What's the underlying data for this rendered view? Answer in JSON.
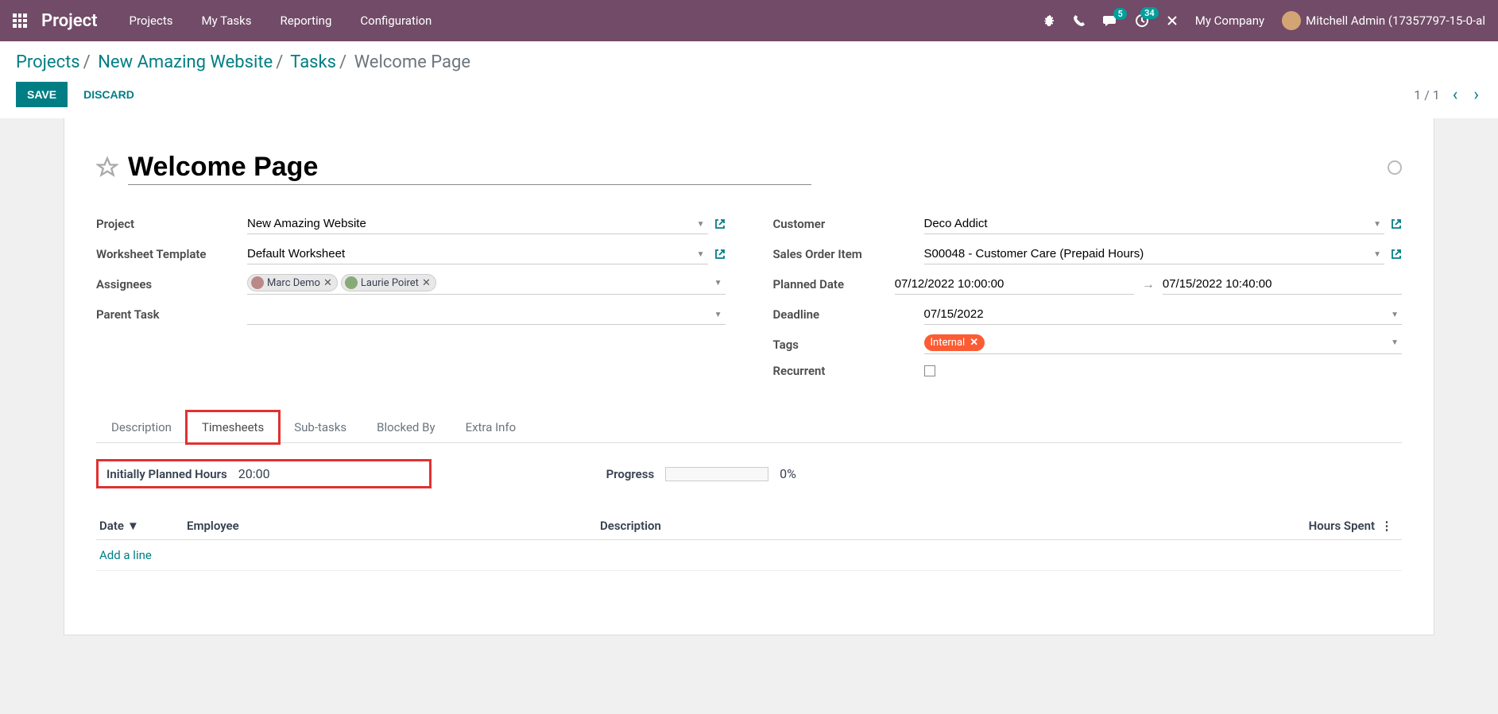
{
  "topbar": {
    "brand": "Project",
    "nav": [
      "Projects",
      "My Tasks",
      "Reporting",
      "Configuration"
    ],
    "chat_badge": "5",
    "activity_badge": "34",
    "company": "My Company",
    "user": "Mitchell Admin (17357797-15-0-al"
  },
  "breadcrumb": {
    "items": [
      "Projects",
      "New Amazing Website",
      "Tasks"
    ],
    "current": "Welcome Page"
  },
  "actions": {
    "save": "SAVE",
    "discard": "DISCARD"
  },
  "pager": {
    "text": "1 / 1"
  },
  "record": {
    "title": "Welcome Page",
    "left": {
      "project": {
        "label": "Project",
        "value": "New Amazing Website"
      },
      "worksheet": {
        "label": "Worksheet Template",
        "value": "Default Worksheet"
      },
      "assignees": {
        "label": "Assignees",
        "values": [
          "Marc Demo",
          "Laurie Poiret"
        ]
      },
      "parent": {
        "label": "Parent Task",
        "value": ""
      }
    },
    "right": {
      "customer": {
        "label": "Customer",
        "value": "Deco Addict"
      },
      "so_item": {
        "label": "Sales Order Item",
        "value": "S00048 - Customer Care (Prepaid Hours)"
      },
      "planned_date": {
        "label": "Planned Date",
        "start": "07/12/2022 10:00:00",
        "end": "07/15/2022 10:40:00"
      },
      "deadline": {
        "label": "Deadline",
        "value": "07/15/2022"
      },
      "tags": {
        "label": "Tags",
        "values": [
          "Internal"
        ]
      },
      "recurrent": {
        "label": "Recurrent"
      }
    }
  },
  "tabs": [
    "Description",
    "Timesheets",
    "Sub-tasks",
    "Blocked By",
    "Extra Info"
  ],
  "timesheets": {
    "planned_label": "Initially Planned Hours",
    "planned_value": "20:00",
    "progress_label": "Progress",
    "progress_value": "0%",
    "columns": {
      "date": "Date",
      "employee": "Employee",
      "description": "Description",
      "hours": "Hours Spent"
    },
    "add_line": "Add a line"
  }
}
